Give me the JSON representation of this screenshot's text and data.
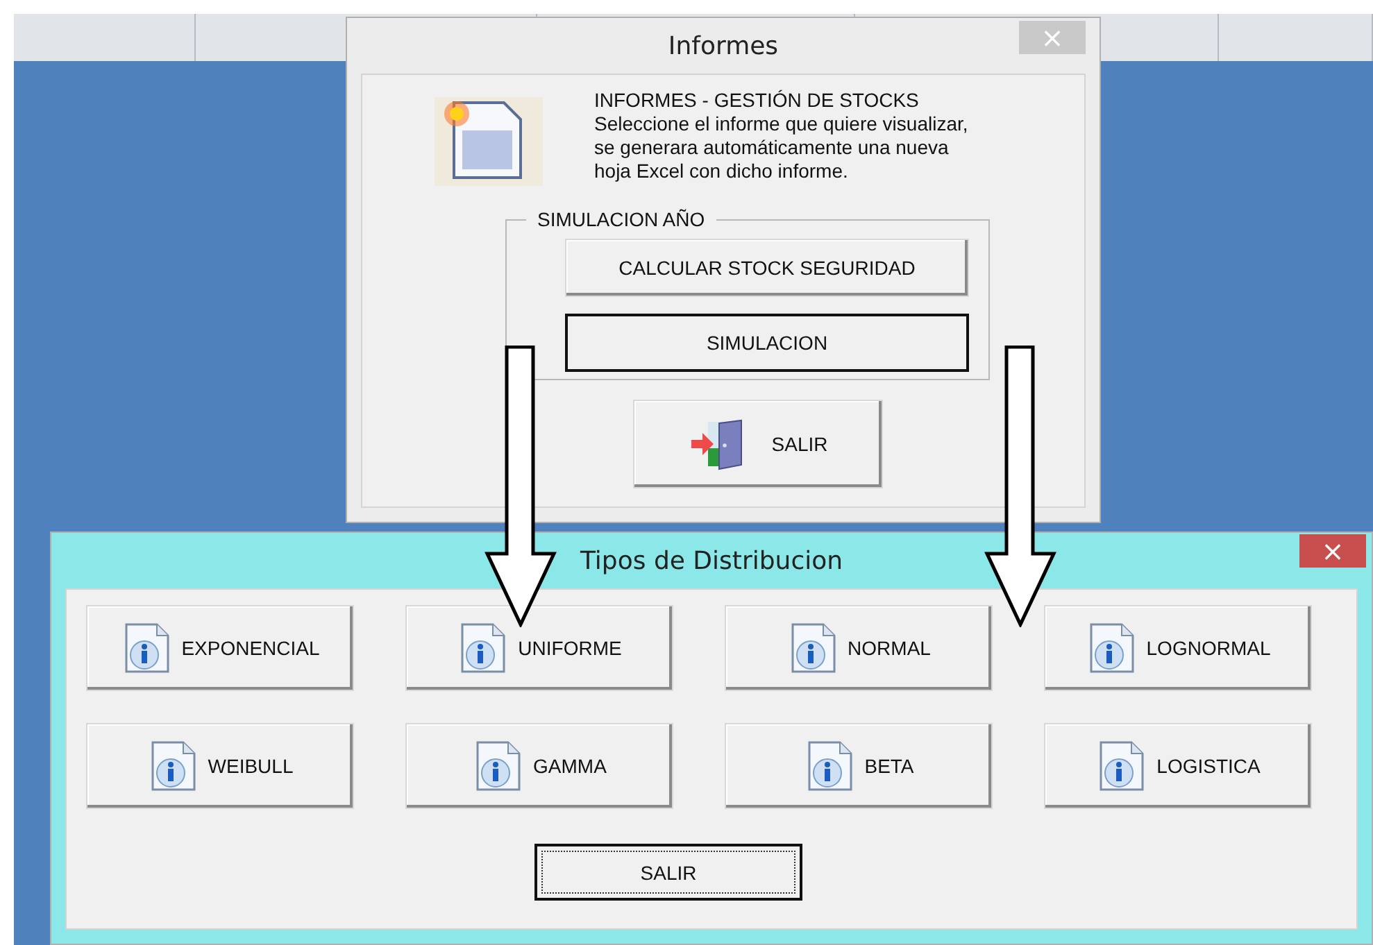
{
  "informes": {
    "title": "Informes",
    "close": "×",
    "lines": [
      "INFORMES - GESTIÓN DE STOCKS",
      "Seleccione el informe que quiere visualizar,",
      "se generara automáticamente una nueva",
      "hoja Excel con dicho informe."
    ],
    "group": {
      "legend": "SIMULACION AÑO",
      "buttons": [
        {
          "label": "CALCULAR STOCK SEGURIDAD",
          "default": false
        },
        {
          "label": "SIMULACION",
          "default": true
        }
      ]
    },
    "exit": {
      "label": "SALIR"
    }
  },
  "tipos": {
    "title": "Tipos de Distribucion",
    "close": "×",
    "buttons": [
      {
        "label": "EXPONENCIAL"
      },
      {
        "label": "UNIFORME"
      },
      {
        "label": "NORMAL"
      },
      {
        "label": "LOGNORMAL"
      },
      {
        "label": "WEIBULL"
      },
      {
        "label": "GAMMA"
      },
      {
        "label": "BETA"
      },
      {
        "label": "LOGISTICA"
      }
    ],
    "exit": {
      "label": "SALIR",
      "focused": true
    }
  }
}
